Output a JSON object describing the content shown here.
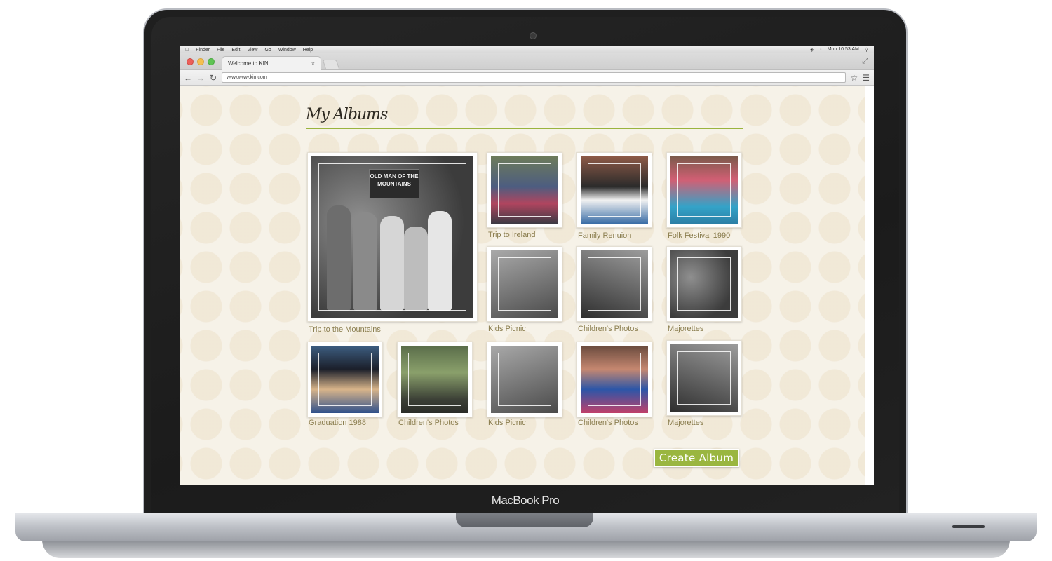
{
  "device": {
    "brand": "MacBook Pro"
  },
  "browser": {
    "menubar": {
      "items": [
        "Finder",
        "File",
        "Edit",
        "View",
        "Go",
        "Window",
        "Help"
      ],
      "clock": "Mon 10:53 AM"
    },
    "tab": {
      "title": "Welcome to KIN",
      "close": "×"
    },
    "url": "www.www.kin.com"
  },
  "page": {
    "title": "My Albums",
    "create_button": "Create Album",
    "albums": [
      {
        "caption": "Trip to the Mountains",
        "sign": "OLD MAN OF THE MOUNTAINS"
      },
      {
        "caption": "Trip to Ireland"
      },
      {
        "caption": "Family Renuion"
      },
      {
        "caption": "Folk Festival 1990"
      },
      {
        "caption": "Kids Picnic"
      },
      {
        "caption": "Children's Photos"
      },
      {
        "caption": "Majorettes"
      },
      {
        "caption": "Graduation 1988"
      },
      {
        "caption": "Children's Photos"
      },
      {
        "caption": "Kids Picnic"
      },
      {
        "caption": "Children's Photos"
      },
      {
        "caption": "Majorettes"
      }
    ]
  },
  "colors": {
    "accent": "#9ab640",
    "caption": "#8a7d4e",
    "rule": "#9ab43e"
  }
}
